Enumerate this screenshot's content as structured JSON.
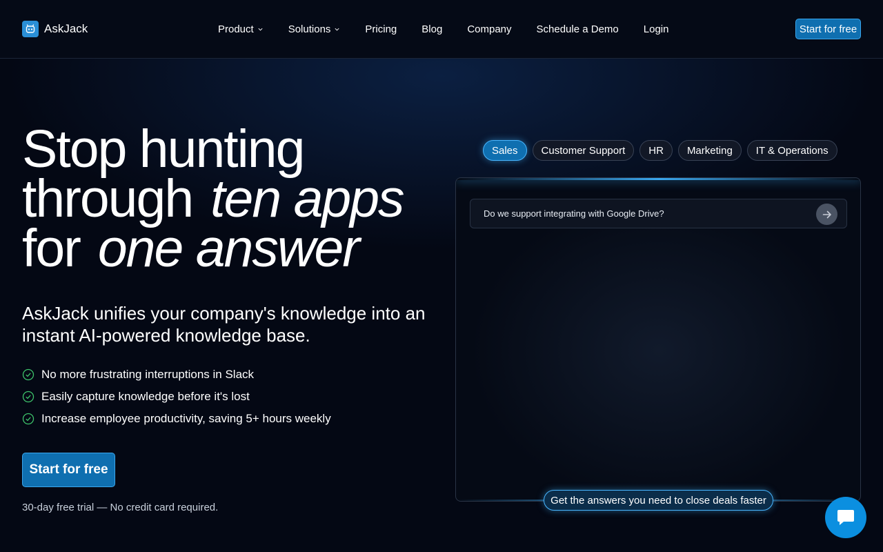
{
  "brand": {
    "name": "AskJack",
    "icon": "robot-face-icon",
    "accent": "#0f6fb0"
  },
  "nav": {
    "items": [
      {
        "label": "Product",
        "dropdown": true
      },
      {
        "label": "Solutions",
        "dropdown": true
      },
      {
        "label": "Pricing",
        "dropdown": false
      },
      {
        "label": "Blog",
        "dropdown": false
      },
      {
        "label": "Company",
        "dropdown": false
      },
      {
        "label": "Schedule a Demo",
        "dropdown": false
      },
      {
        "label": "Login",
        "dropdown": false
      }
    ],
    "cta": "Start for free"
  },
  "hero": {
    "line1": "Stop hunting",
    "line2_plain": "through",
    "line2_highlight": "ten apps",
    "line3_plain": "for",
    "line3_highlight": "one answer",
    "subtitle": "AskJack unifies your company's knowledge into an instant AI-powered knowledge base.",
    "features": [
      "No more frustrating interruptions in Slack",
      "Easily capture knowledge before it's lost",
      "Increase employee productivity, saving 5+ hours weekly"
    ],
    "cta": "Start for free",
    "note": "30-day free trial — No credit card required."
  },
  "demo": {
    "tabs": [
      {
        "label": "Sales",
        "active": true
      },
      {
        "label": "Customer Support",
        "active": false
      },
      {
        "label": "HR",
        "active": false
      },
      {
        "label": "Marketing",
        "active": false
      },
      {
        "label": "IT & Operations",
        "active": false
      }
    ],
    "query": "Do we support integrating with Google Drive?",
    "caption": "Get the answers you need to close deals faster"
  },
  "chat": {
    "icon": "chat-bubble-icon",
    "color": "#0b8fe0"
  }
}
